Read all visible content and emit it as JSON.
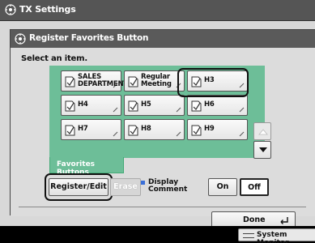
{
  "window": {
    "title": "TX Settings"
  },
  "dialog": {
    "title": "Register Favorites Button",
    "prompt": "Select an item."
  },
  "favorites": {
    "buttons": [
      {
        "label": "SALES\nDEPARTMENT",
        "selected": false
      },
      {
        "label": "Regular\nMeeting",
        "selected": false
      },
      {
        "label": "H3",
        "selected": true
      },
      {
        "label": "H4",
        "selected": false
      },
      {
        "label": "H5",
        "selected": false
      },
      {
        "label": "H6",
        "selected": false
      },
      {
        "label": "H7",
        "selected": false
      },
      {
        "label": "H8",
        "selected": false
      },
      {
        "label": "H9",
        "selected": false
      }
    ],
    "tab_label": "Favorites Buttons"
  },
  "controls": {
    "register_edit": "Register/Edit",
    "erase": "Erase",
    "display_comment": "Display\nComment",
    "on": "On",
    "off": "Off",
    "display_comment_value": "Off",
    "done": "Done"
  },
  "system_monitor": {
    "label": "System Monitor"
  },
  "colors": {
    "accent": "#6dbe98",
    "title_bar": "#555555",
    "highlight": "#3a6fd8"
  }
}
